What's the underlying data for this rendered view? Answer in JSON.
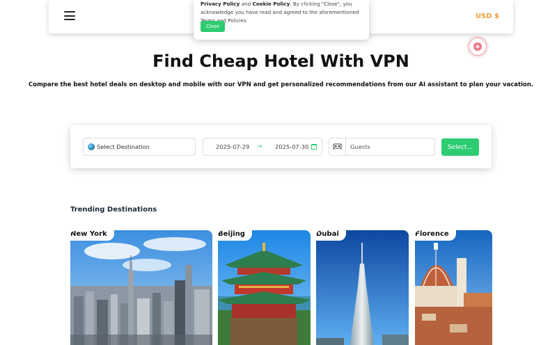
{
  "header": {
    "menu_icon": "hamburger-menu-icon",
    "currency_label": "USD $"
  },
  "cookie": {
    "privacy_link": "Privacy Policy",
    "and_text": " and ",
    "cookie_link": "Cookie Policy",
    "message": ". By clicking \"Close\", you acknowledge you have read and agreed to the aforementioned Terms and Policies",
    "close_label": "Close"
  },
  "ai_assistant": {
    "icon": "sparkle-icon"
  },
  "hero": {
    "title": "Find Cheap Hotel With VPN",
    "subtitle": "Compare the best hotel deals on desktop and mobile with our VPN and get personalized recommendations from our AI assistant to plan your vacation."
  },
  "search": {
    "destination_label": "Select Destination",
    "checkin": "2025-07-29",
    "checkout": "2025-07-30",
    "arrow": "→",
    "guests_placeholder": "Guests",
    "submit_label": "Select..."
  },
  "trending": {
    "title": "Trending Destinations",
    "destinations": [
      {
        "name": "New York"
      },
      {
        "name": "Beijing"
      },
      {
        "name": "Dubai"
      },
      {
        "name": "Florence"
      }
    ]
  },
  "colors": {
    "accent_green": "#2ecc71",
    "currency_orange": "#e8a13a",
    "ai_badge_pink": "#e9a0a8"
  }
}
